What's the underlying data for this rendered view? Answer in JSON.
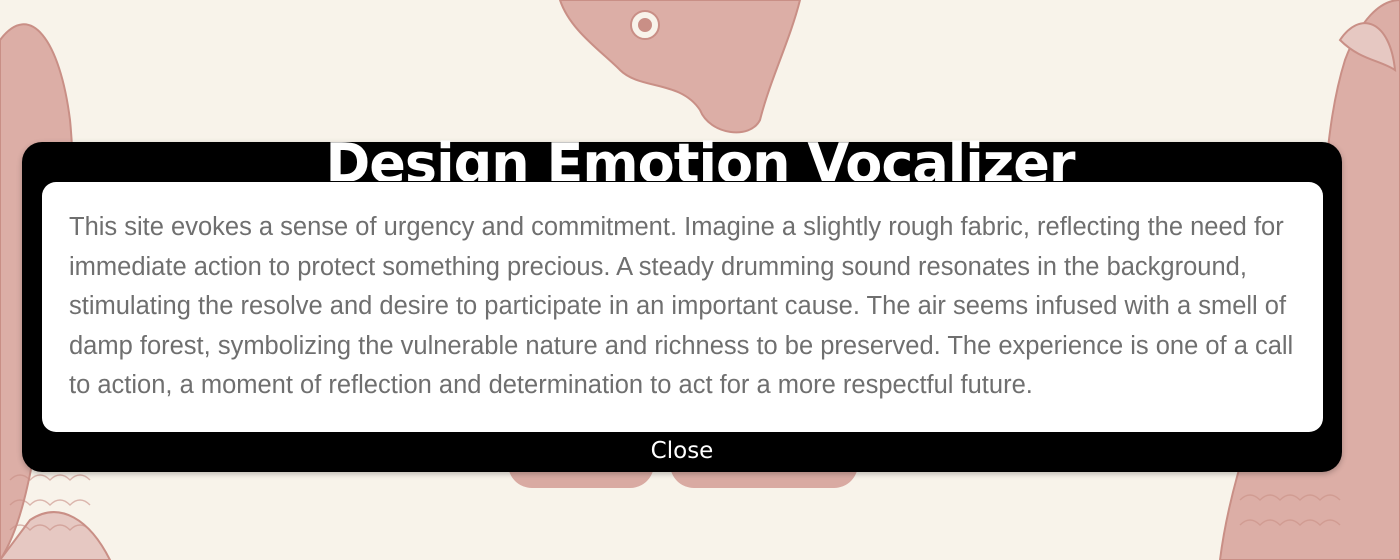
{
  "modal": {
    "title": "Design Emotion Vocalizer",
    "description": "This site evokes a sense of urgency and commitment. Imagine a slightly rough fabric, reflecting the need for immediate action to protect something precious. A steady drumming sound resonates in the background, stimulating the resolve and desire to participate in an important cause. The air seems infused with a smell of damp forest, symbolizing the vulnerable nature and richness to be preserved. The experience is one of a call to action, a moment of reflection and determination to act for a more respectful future.",
    "close_label": "Close"
  },
  "colors": {
    "page_background": "#f8f3ea",
    "illustration": "#d9aaa2",
    "modal_frame": "#000000",
    "modal_body": "#ffffff",
    "body_text": "#6f6f6f"
  },
  "background": {
    "illustration": "engraved-fish-illustrations"
  }
}
